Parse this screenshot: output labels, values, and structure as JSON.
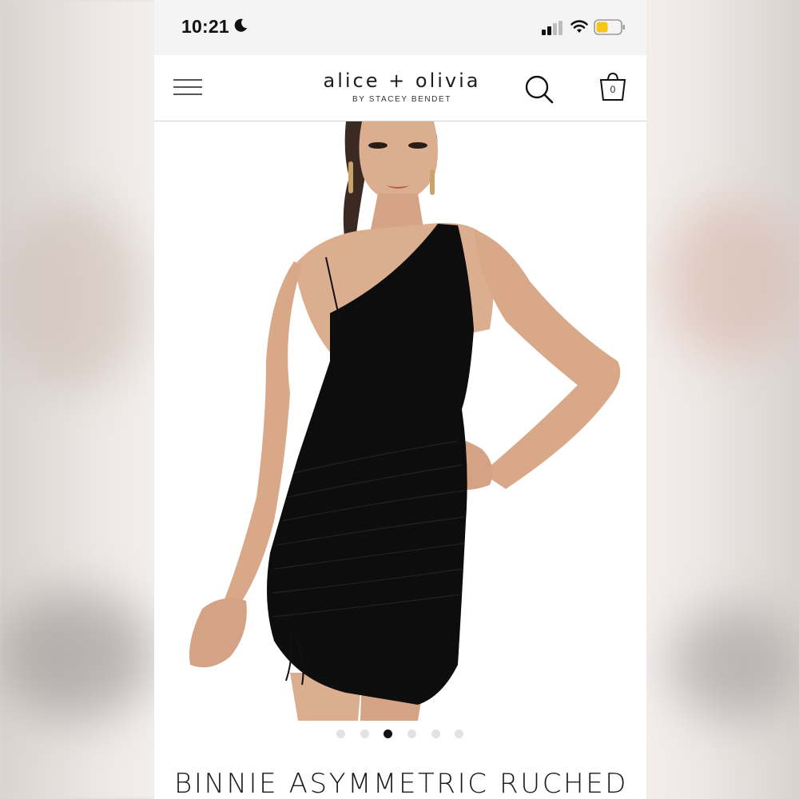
{
  "status_bar": {
    "time": "10:21",
    "icons": [
      "moon-icon",
      "signal-icon",
      "wifi-icon",
      "battery-icon"
    ],
    "battery_color": "#f5c518"
  },
  "header": {
    "brand_name": "alice + olivia",
    "brand_sub": "BY STACEY BENDET",
    "bag_count": "0",
    "icons": [
      "menu-icon",
      "search-icon",
      "bag-icon"
    ]
  },
  "product": {
    "image_alt_semantic": "model-wearing-black-one-shoulder-ruched-dress",
    "dress_color": "#0d0d0d",
    "title": "BINNIE ASYMMETRIC RUCHED"
  },
  "carousel": {
    "total": 6,
    "active_index": 2
  }
}
